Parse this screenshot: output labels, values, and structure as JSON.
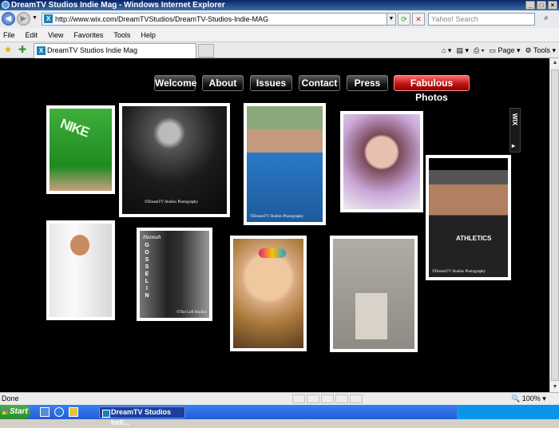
{
  "window": {
    "title": "DreamTV Studios Indie Mag - Windows Internet Explorer"
  },
  "addressbar": {
    "url": "http://www.wix.com/DreamTVStudios/DreamTV-Studios-Indie-MAG",
    "search_placeholder": "Yahoo! Search"
  },
  "menu": [
    "File",
    "Edit",
    "View",
    "Favorites",
    "Tools",
    "Help"
  ],
  "tab": {
    "title": "DreamTV Studios Indie Mag"
  },
  "toolbar": {
    "page": "Page",
    "tools": "Tools"
  },
  "site": {
    "nav": [
      "Welcome",
      "About",
      "Issues",
      "Contact",
      "Press",
      "Fabulous Photos"
    ],
    "active_nav": "Fabulous Photos",
    "photos": [
      {
        "name": "green-nike-shirt",
        "caption": ""
      },
      {
        "name": "bw-man-with-glasses",
        "caption": "©DreamTV Studios Photography"
      },
      {
        "name": "teen-blue-shirt",
        "caption": "©DreamTV Studios Photography"
      },
      {
        "name": "girl-with-makeup",
        "caption": ""
      },
      {
        "name": "man-with-hat",
        "caption": "©DreamTV Studios Photography"
      },
      {
        "name": "white-shirt-boy",
        "caption": ""
      },
      {
        "name": "hannah-gosselin",
        "caption": "©The Loft Studios"
      },
      {
        "name": "boy-with-sunglasses",
        "caption": ""
      },
      {
        "name": "child-on-block",
        "caption": ""
      }
    ],
    "hannah_title": "Hannah",
    "gosselin_letters": [
      "G",
      "O",
      "S",
      "S",
      "E",
      "L",
      "I",
      "N"
    ],
    "wix_label": "WIX"
  },
  "status": {
    "text": "Done",
    "zoom": "100%"
  },
  "taskbar": {
    "start": "Start",
    "window_button": "DreamTV Studios Indi..."
  },
  "colors": {
    "active_nav": "#c01616",
    "page_bg": "#000000",
    "titlebar": "#0a246a"
  }
}
